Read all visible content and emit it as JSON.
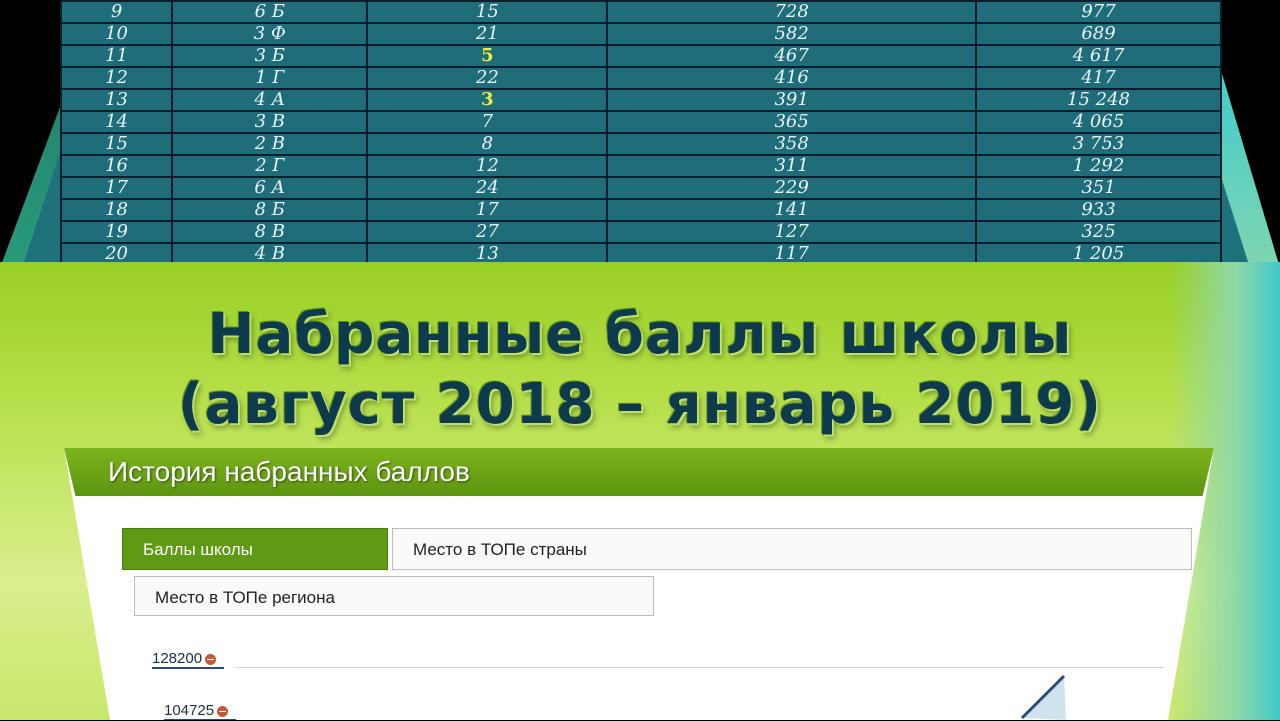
{
  "ranking_table": {
    "rows": [
      [
        "9",
        "6 Б",
        "15",
        "728",
        "977"
      ],
      [
        "10",
        "3 Ф",
        "21",
        "582",
        "689"
      ],
      [
        "11",
        "3 Б",
        "5",
        "467",
        "4 617"
      ],
      [
        "12",
        "1 Г",
        "22",
        "416",
        "417"
      ],
      [
        "13",
        "4 А",
        "3",
        "391",
        "15 248"
      ],
      [
        "14",
        "3 В",
        "7",
        "365",
        "4 065"
      ],
      [
        "15",
        "2 В",
        "8",
        "358",
        "3 753"
      ],
      [
        "16",
        "2 Г",
        "12",
        "311",
        "1 292"
      ],
      [
        "17",
        "6 А",
        "24",
        "229",
        "351"
      ],
      [
        "18",
        "8 Б",
        "17",
        "141",
        "933"
      ],
      [
        "19",
        "8 В",
        "27",
        "127",
        "325"
      ],
      [
        "20",
        "4 В",
        "13",
        "117",
        "1 205"
      ]
    ],
    "highlighted_values": [
      "5",
      "3"
    ]
  },
  "heading": {
    "line1": "Набранные баллы школы",
    "line2": "(август 2018 – январь 2019)"
  },
  "panel": {
    "title": "История набранных баллов",
    "tabs": [
      {
        "label": "Баллы школы",
        "active": true
      },
      {
        "label": "Место в ТОПе страны",
        "active": false
      },
      {
        "label": "Место в ТОПе региона",
        "active": false
      }
    ]
  },
  "chart": {
    "y_ticks": [
      "128200",
      "104725"
    ],
    "colors": {
      "line": "#2b4a7a",
      "area": "#cfe3ee",
      "dot": "#c65a35"
    }
  },
  "colors": {
    "table_cell": "#1f6c7a",
    "highlight": "#f2ee3a",
    "title_text": "#0e3a4d",
    "tab_active": "#5e9a13"
  }
}
